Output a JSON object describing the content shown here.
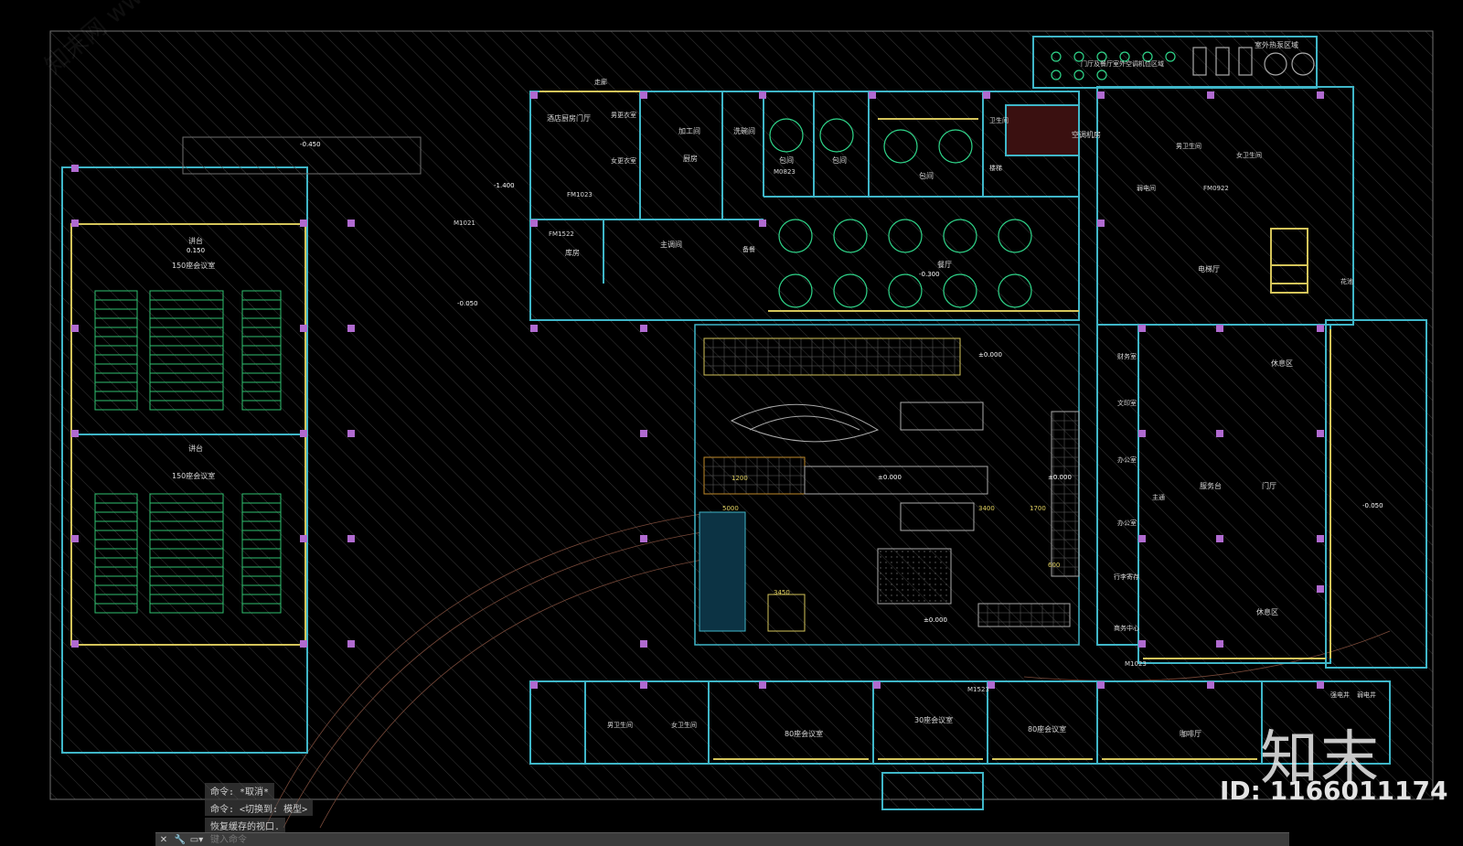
{
  "rooms": {
    "conf150_top": "150座会议室",
    "conf150_bottom": "150座会议室",
    "stage_top": "讲台",
    "stage_bottom": "讲台",
    "hotel_lobby": "酒店厨房门厅",
    "male_locker": "男更衣室",
    "female_locker": "女更衣室",
    "processing": "加工间",
    "washing": "洗碗间",
    "kitchen": "厨房",
    "private1": "包间",
    "private2": "包间",
    "private3": "包间",
    "restroom_top": "卫生间",
    "fire_exit": "楼梯",
    "weak_room": "弱电间",
    "dining": "餐厅",
    "storage": "库房",
    "main_prep": "主调间",
    "prep": "备餐",
    "finance": "财务室",
    "document": "文印室",
    "office1": "办公室",
    "office2": "办公室",
    "luggage": "行李寄存",
    "business": "商务中心",
    "lobby": "门厅",
    "service": "服务台",
    "rest_area_top": "休息区",
    "rest_area_bottom": "休息区",
    "main_hall": "主通",
    "elevator_hall": "电梯厅",
    "male_wc": "男卫生间",
    "female_wc": "女卫生间",
    "conf80_left": "80座会议室",
    "conf30": "30座会议室",
    "conf80_right": "80座会议室",
    "cafe": "咖啡厅",
    "male_wc_b": "男卫生间",
    "female_wc_b": "女卫生间",
    "strong_well": "强电井",
    "weak_well": "弱电井",
    "outdoor_equip": "室外热泵区域",
    "ac_platform": "门厅及餐厅室外空调机位区域",
    "flower_pool": "花池",
    "corridor": "走廊",
    "unit_mech": "空调机房"
  },
  "dims": {
    "d5000": "5000",
    "d3400": "3400",
    "d1700": "1700",
    "d3450": "3450",
    "d1200": "1200",
    "d600": "600"
  },
  "levels": {
    "l0": "±0.000",
    "lm050": "-0.050",
    "lm300": "-0.300",
    "l0b": "±0.000",
    "l0c": "±0.000",
    "l0d": "±0.000",
    "lm450": "-0.450",
    "l150": "0.150",
    "lm100": "-1.400",
    "lm050b": "-0.050"
  },
  "door_tags": [
    "M1023",
    "FM1023",
    "M1523",
    "FM0922",
    "M0823",
    "FM1522",
    "M1021"
  ],
  "command_history": {
    "line1": "命令: *取消*",
    "line2": "命令:   <切换到: 模型>",
    "line3": "恢复缓存的视口."
  },
  "command_bar": {
    "placeholder": "键入命令",
    "close_icon": "close-icon",
    "wrench_icon": "wrench-icon",
    "prompt_icon": "command-prompt-icon"
  },
  "watermark": {
    "logo": "知末",
    "id": "ID: 1166011174",
    "diag": "知末网 www.znzmo.com"
  },
  "colors": {
    "background": "#000000",
    "wall": "#3fb6c8",
    "window": "#e0d048",
    "column": "#b06ad0",
    "furniture": "#2fd68a",
    "hatch": "#3c3c3c"
  }
}
